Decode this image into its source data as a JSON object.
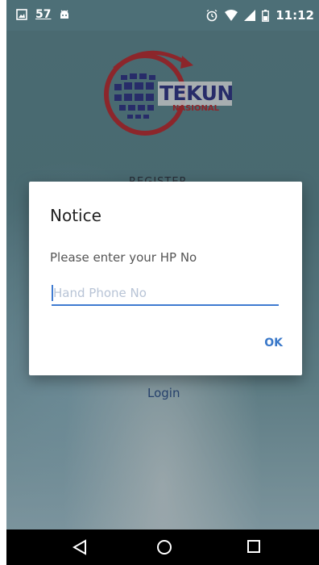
{
  "status_bar": {
    "notification_count": "57",
    "time": "11:12"
  },
  "logo": {
    "main": "TEKUN",
    "sub": "NASIONAL"
  },
  "background_screen": {
    "register_label": "REGISTER",
    "login_label": "Login"
  },
  "dialog": {
    "title": "Notice",
    "message": "Please enter your HP No",
    "input_placeholder": "Hand Phone No",
    "input_value": "",
    "ok_label": "OK"
  },
  "icons": [
    "image-icon",
    "android-icon",
    "alarm-icon",
    "wifi-icon",
    "signal-icon",
    "battery-icon",
    "back-icon",
    "home-icon",
    "recents-icon"
  ],
  "colors": {
    "accent": "#3f7bd1",
    "ok_text": "#3a78c9",
    "logo_blue": "#2b2f86",
    "logo_red": "#c0262b"
  }
}
